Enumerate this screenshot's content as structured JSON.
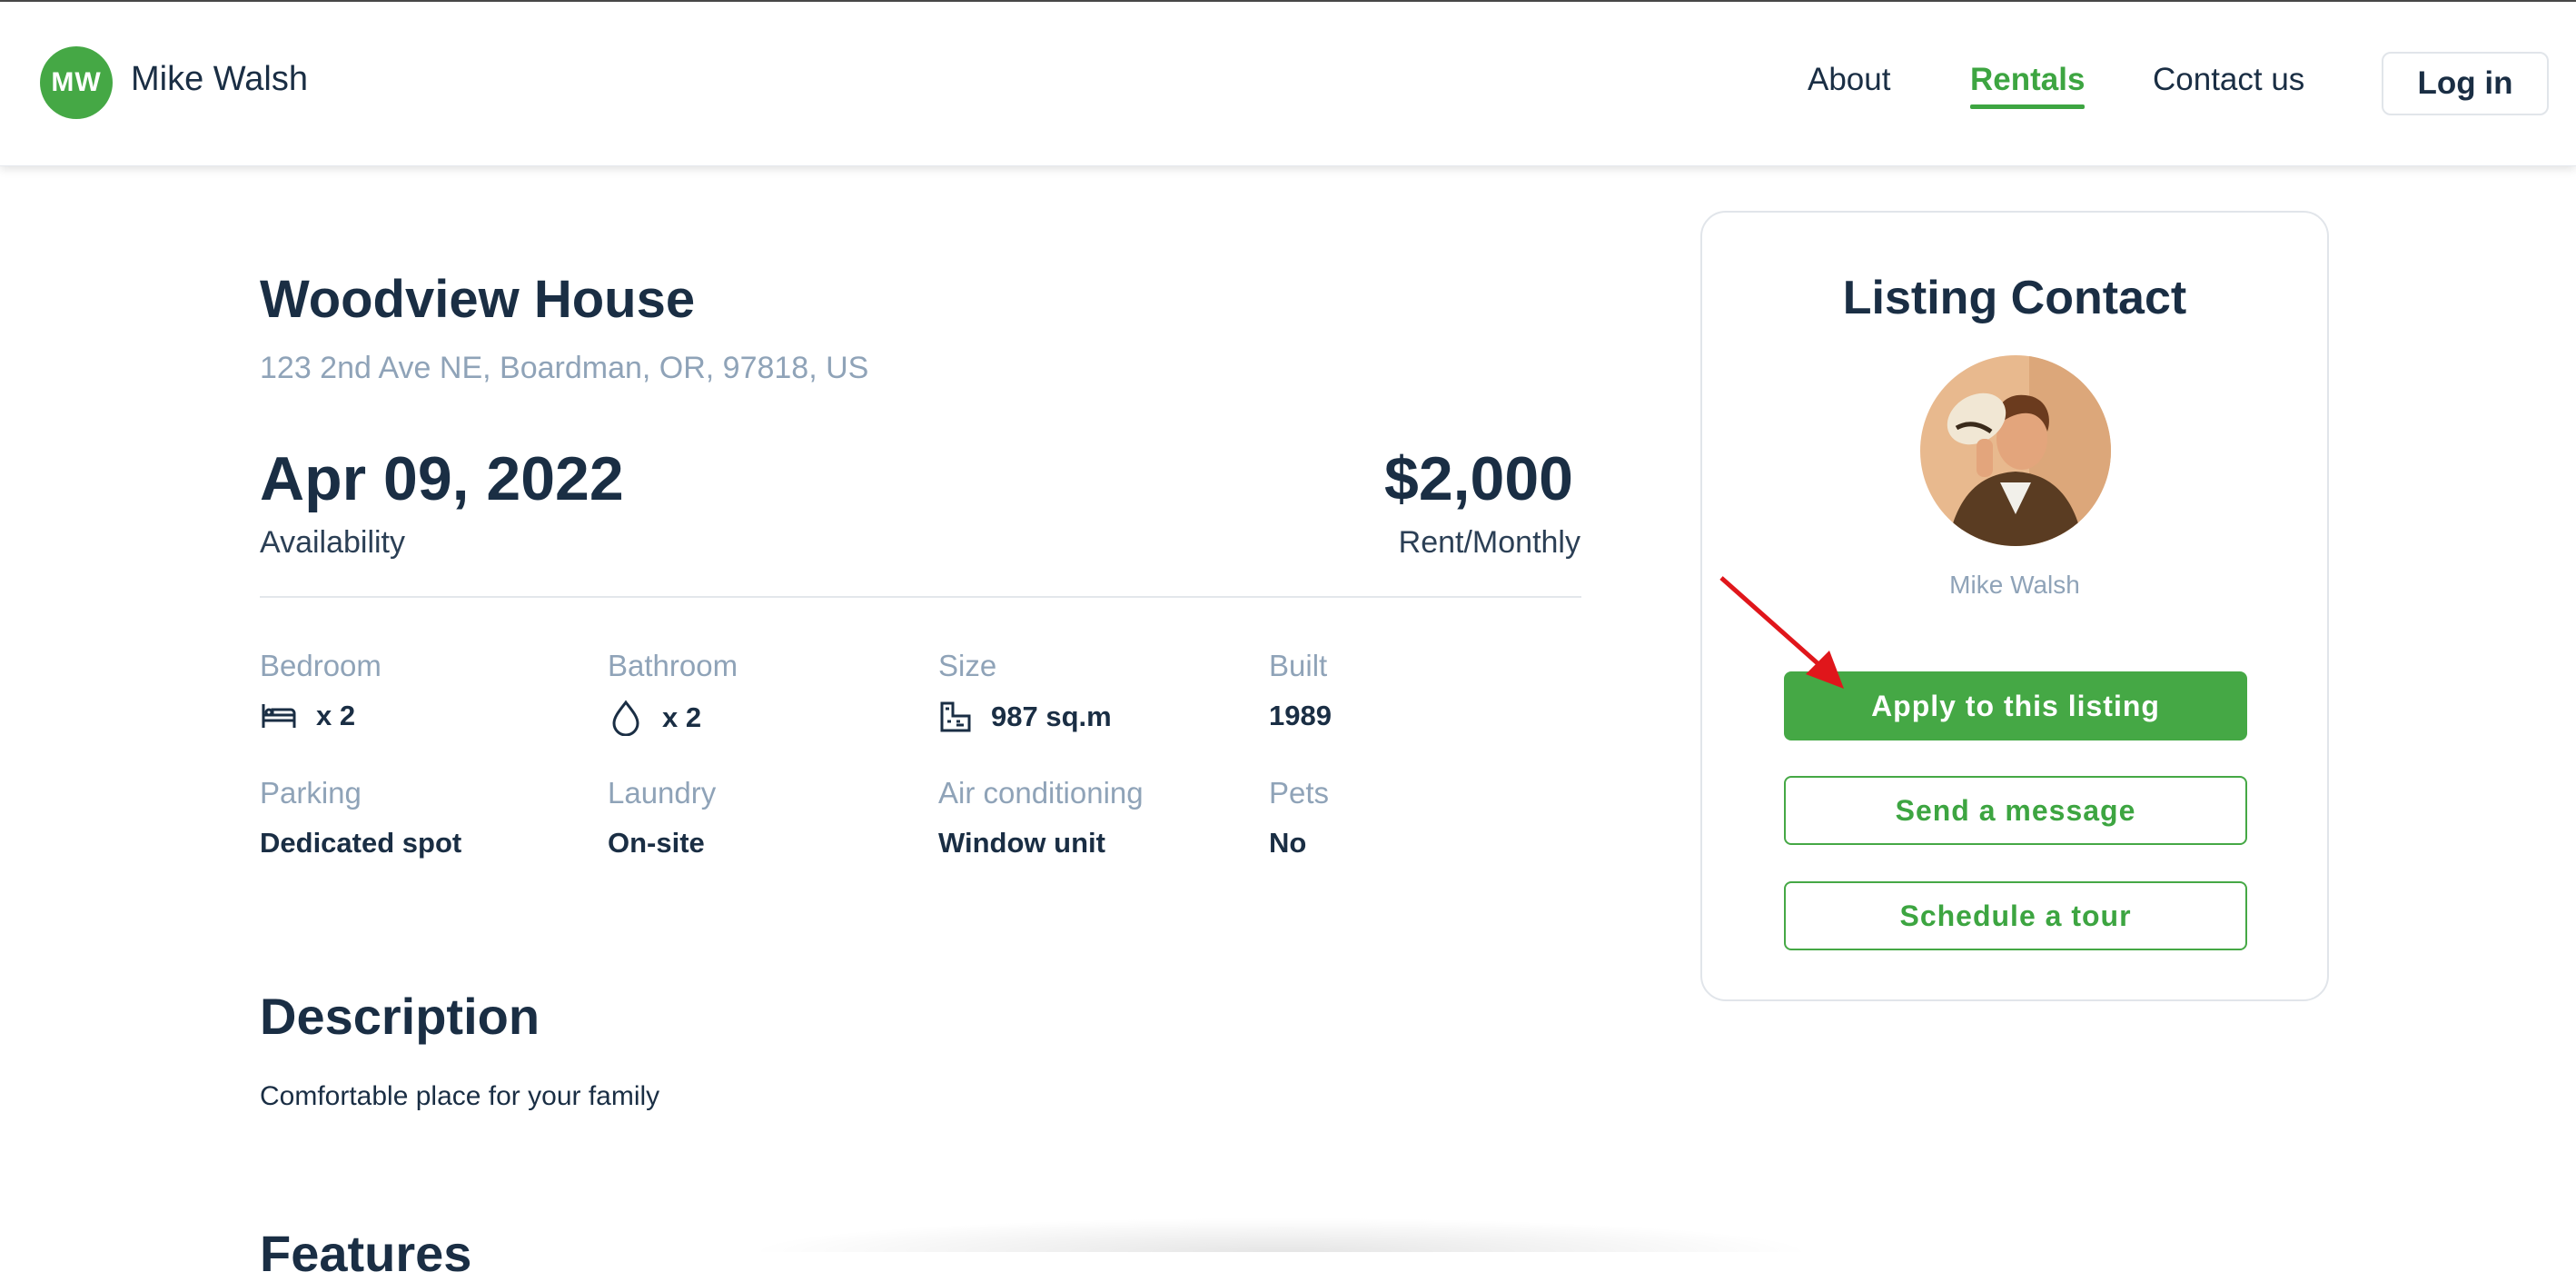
{
  "header": {
    "logo_initials": "MW",
    "brand_name": "Mike Walsh",
    "nav": {
      "about": "About",
      "rentals": "Rentals",
      "contact": "Contact us"
    },
    "login_label": "Log in",
    "active_nav": "Rentals",
    "accent_color": "#45a845"
  },
  "listing": {
    "title": "Woodview House",
    "address": "123 2nd Ave NE, Boardman, OR, 97818, US",
    "availability_date": "Apr 09, 2022",
    "availability_label": "Availability",
    "price": "$2,000",
    "price_label": "Rent/Monthly",
    "features": {
      "bedroom": {
        "label": "Bedroom",
        "value": "x 2",
        "icon": "bed-icon"
      },
      "bathroom": {
        "label": "Bathroom",
        "value": "x 2",
        "icon": "water-drop-icon"
      },
      "size": {
        "label": "Size",
        "value": "987 sq.m",
        "icon": "floorplan-icon"
      },
      "built": {
        "label": "Built",
        "value": "1989"
      },
      "parking": {
        "label": "Parking",
        "value": "Dedicated spot"
      },
      "laundry": {
        "label": "Laundry",
        "value": "On-site"
      },
      "ac": {
        "label": "Air conditioning",
        "value": "Window unit"
      },
      "pets": {
        "label": "Pets",
        "value": "No"
      }
    },
    "description_heading": "Description",
    "description_text": "Comfortable place for your family",
    "features_heading": "Features"
  },
  "contact_card": {
    "title": "Listing Contact",
    "name": "Mike Walsh",
    "apply_label": "Apply to this listing",
    "message_label": "Send a message",
    "tour_label": "Schedule a tour"
  }
}
